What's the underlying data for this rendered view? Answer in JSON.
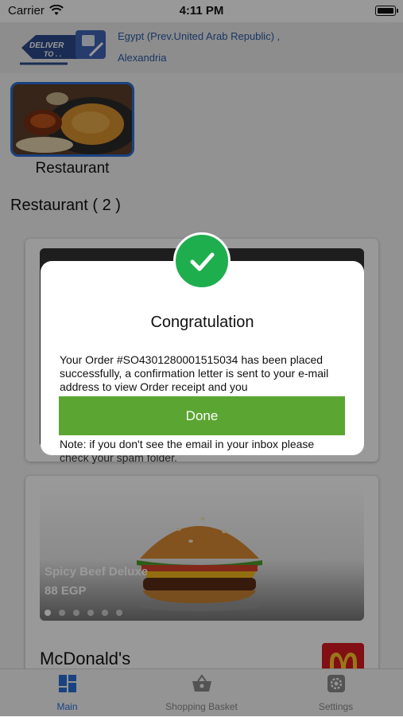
{
  "status_bar": {
    "carrier": "Carrier",
    "time": "4:11 PM"
  },
  "header": {
    "logo_line1": "DELIVER",
    "logo_line2": "TO . .",
    "location_country": "Egypt (Prev.United Arab Republic)  ,",
    "location_city": "Alexandria"
  },
  "category": {
    "label": "Restaurant"
  },
  "section": {
    "title": "Restaurant ( 2 )"
  },
  "restaurant_card": {
    "slide_name": "Spicy Beef Deluxe",
    "slide_price": "88 EGP",
    "slide_count": 6,
    "active_slide": 0,
    "name": "McDonald's"
  },
  "modal": {
    "title": "Congratulation",
    "body": "Your Order #SO4301280001515034 has been placed successfully, a confirmation letter is sent to your e-mail address to view Order receipt and you",
    "done_label": "Done",
    "note_line1": "Note: if you don't see the email in your inbox please",
    "note_line2": "check your spam folder."
  },
  "tabs": [
    {
      "label": "Main",
      "icon": "grid-icon",
      "active": true
    },
    {
      "label": "Shopping Basket",
      "icon": "basket-icon",
      "active": false
    },
    {
      "label": "Settings",
      "icon": "gear-icon",
      "active": false
    }
  ],
  "colors": {
    "accent_blue": "#2a6fd6",
    "success_green": "#1fae4e",
    "done_button": "#5ba632",
    "mcdonalds_red": "#d71920",
    "mcdonalds_yellow": "#ffc72c"
  }
}
